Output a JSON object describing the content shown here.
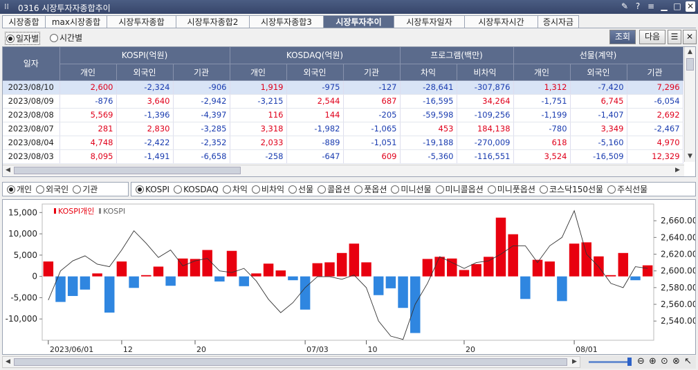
{
  "window": {
    "title": "0316 시장투자자종합추이"
  },
  "tabs": [
    "시장종합",
    "max시장종합",
    "시장투자종합",
    "시장투자종합2",
    "시장투자종합3",
    "시장투자추이",
    "시장투자일자",
    "시장투자시간",
    "증시자금"
  ],
  "active_tab": 5,
  "period": {
    "daily": "일자별",
    "hourly": "시간별"
  },
  "buttons": {
    "query": "조회",
    "next": "다음"
  },
  "table": {
    "date_header": "일자",
    "groups": [
      "KOSPI(억원)",
      "KOSDAQ(억원)",
      "프로그램(백만)",
      "선물(계약)"
    ],
    "subheaders": [
      "개인",
      "외국인",
      "기관",
      "개인",
      "외국인",
      "기관",
      "차익",
      "비차익",
      "개인",
      "외국인",
      "기관"
    ],
    "rows": [
      [
        "2023/08/10",
        "2,600",
        "-2,324",
        "-906",
        "1,919",
        "-975",
        "-127",
        "-28,641",
        "-307,876",
        "1,312",
        "-7,420",
        "7,296"
      ],
      [
        "2023/08/09",
        "-876",
        "3,640",
        "-2,942",
        "-3,215",
        "2,544",
        "687",
        "-16,595",
        "34,264",
        "-1,751",
        "6,745",
        "-6,054"
      ],
      [
        "2023/08/08",
        "5,569",
        "-1,396",
        "-4,397",
        "116",
        "144",
        "-205",
        "-59,598",
        "-109,256",
        "-1,199",
        "-1,407",
        "2,692"
      ],
      [
        "2023/08/07",
        "281",
        "2,830",
        "-3,285",
        "3,318",
        "-1,982",
        "-1,065",
        "453",
        "184,138",
        "-780",
        "3,349",
        "-2,467"
      ],
      [
        "2023/08/04",
        "4,748",
        "-2,422",
        "-2,352",
        "2,033",
        "-889",
        "-1,051",
        "-19,188",
        "-270,009",
        "618",
        "-5,160",
        "4,970"
      ],
      [
        "2023/08/03",
        "8,095",
        "-1,491",
        "-6,658",
        "-258",
        "-647",
        "609",
        "-5,360",
        "-116,551",
        "3,524",
        "-16,509",
        "12,329"
      ]
    ]
  },
  "investor_options": [
    "개인",
    "외국인",
    "기관"
  ],
  "investor_selected": 0,
  "market_options": [
    "KOSPI",
    "KOSDAQ",
    "차익",
    "비차익",
    "선물",
    "콜옵션",
    "풋옵션",
    "미니선물",
    "미니콜옵션",
    "미니풋옵션",
    "코스닥150선물",
    "주식선물"
  ],
  "market_selected": 0,
  "colors": {
    "positive": "#e8000f",
    "negative": "#2f86e0",
    "index_line": "#333333",
    "header": "#5b6b8c"
  },
  "chart_data": {
    "type": "bar",
    "legend": [
      "KOSPI개인",
      "KOSPI"
    ],
    "y_left": {
      "ticks": [
        "15,000",
        "10,000",
        "5,000",
        "0",
        "-5,000",
        "-10,000"
      ],
      "range": [
        -15000,
        17000
      ]
    },
    "y_right": {
      "ticks": [
        "2,660.00",
        "2,640.00",
        "2,620.00",
        "2,600.00",
        "2,580.00",
        "2,560.00",
        "2,540.00"
      ],
      "range": [
        2517,
        2680
      ]
    },
    "x_labels": [
      {
        "label": "2023/06/01",
        "index": 0
      },
      {
        "label": "12",
        "index": 6
      },
      {
        "label": "20",
        "index": 12
      },
      {
        "label": "07/03",
        "index": 21
      },
      {
        "label": "10",
        "index": 26
      },
      {
        "label": "20",
        "index": 34
      },
      {
        "label": "08/01",
        "index": 43
      }
    ],
    "series": [
      {
        "name": "KOSPI개인",
        "values": [
          3500,
          -6000,
          -4600,
          -3100,
          700,
          -8500,
          3500,
          -2700,
          300,
          2300,
          -2200,
          4200,
          4100,
          6200,
          -1200,
          6000,
          -2300,
          700,
          3000,
          1400,
          -900,
          -7800,
          3100,
          3300,
          5500,
          7700,
          3300,
          -4400,
          -2800,
          -7400,
          -13300,
          4100,
          4600,
          4200,
          1500,
          2900,
          4600,
          13800,
          9900,
          -5300,
          3900,
          3500,
          -5800,
          7700,
          8000,
          4700,
          300,
          5500,
          -900,
          2600
        ]
      },
      {
        "name": "KOSPI",
        "values": [
          2565,
          2600,
          2612,
          2618,
          2608,
          2605,
          2625,
          2648,
          2633,
          2616,
          2625,
          2606,
          2612,
          2615,
          2600,
          2598,
          2603,
          2588,
          2566,
          2550,
          2562,
          2580,
          2593,
          2593,
          2590,
          2595,
          2580,
          2540,
          2522,
          2518,
          2560,
          2585,
          2617,
          2610,
          2603,
          2610,
          2612,
          2620,
          2630,
          2630,
          2610,
          2630,
          2640,
          2672,
          2620,
          2605,
          2585,
          2580,
          2605,
          2603
        ]
      }
    ]
  }
}
